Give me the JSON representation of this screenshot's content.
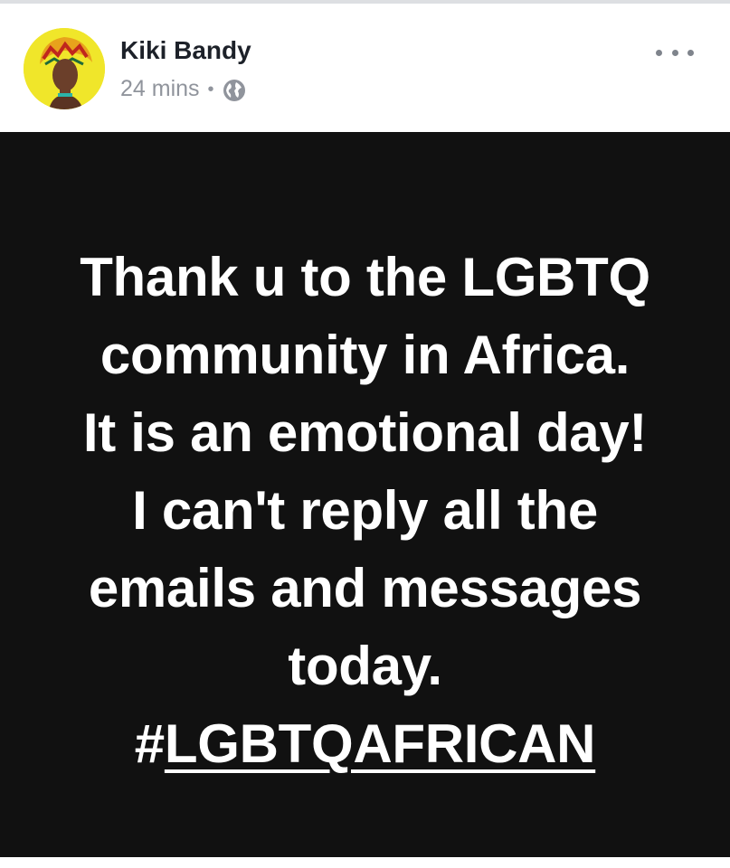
{
  "post": {
    "author": {
      "name": "Kiki Bandy",
      "avatar_icon": "profile-avatar"
    },
    "meta": {
      "time": "24 mins",
      "separator": "•",
      "audience_icon": "globe-icon"
    },
    "more_icon": "more-options-icon",
    "image_text": {
      "lines": [
        "Thank u to the LGBTQ",
        "community in Africa.",
        "It is an emotional day!",
        "I can't reply all the",
        "emails and messages",
        "today."
      ],
      "hashtag_symbol": "#",
      "hashtag_text": "LGBTQAFRICAN"
    }
  },
  "colors": {
    "image_background": "#111111",
    "image_text": "#ffffff",
    "name_text": "#1d2129",
    "meta_text": "#90949c",
    "avatar_background": "#f0e62a"
  }
}
